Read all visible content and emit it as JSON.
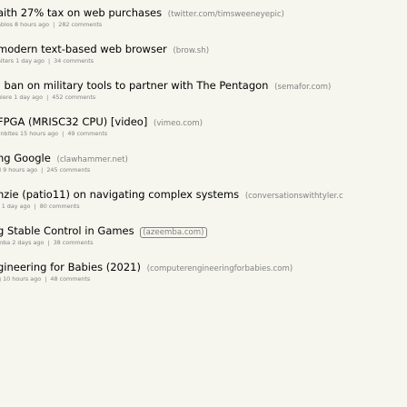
{
  "stories": [
    {
      "title": "aith 27% tax on web purchases",
      "site": "(twitter.com/timsweeneyepic)",
      "author": "ablos",
      "age": "8 hours ago",
      "comments": "282 comments"
    },
    {
      "title": "modern text-based web browser",
      "site": "(brow.sh)",
      "author": "alters",
      "age": "1 day ago",
      "comments": "34 comments"
    },
    {
      "title": "; ban on military tools to partner with The Pentagon",
      "site": "(semafor.com)",
      "author": "uiere",
      "age": "1 day ago",
      "comments": "452 comments"
    },
    {
      "title": "FPGA (MRISC32 CPU) [video]",
      "site": "(vimeo.com)",
      "author": "snbites",
      "age": "15 hours ago",
      "comments": "49 comments"
    },
    {
      "title": "ng Google",
      "site": "(clawhammer.net)",
      "author": "d",
      "age": "9 hours ago",
      "comments": "245 comments"
    },
    {
      "title": "nzie (patio11) on navigating complex systems",
      "site": "(conversationswithtyler.c",
      "author": "r",
      "age": "1 day ago",
      "comments": "80 comments"
    },
    {
      "title": "g Stable Control in Games",
      "site": "(azeemba.com)",
      "author": "mba",
      "age": "2 days ago",
      "comments": "38 comments"
    },
    {
      "title": "gineering for Babies (2021)",
      "site": "(computerengineeringforbabies.com)",
      "author": "g",
      "age": "10 hours ago",
      "comments": "48 comments"
    }
  ],
  "separator": "|"
}
